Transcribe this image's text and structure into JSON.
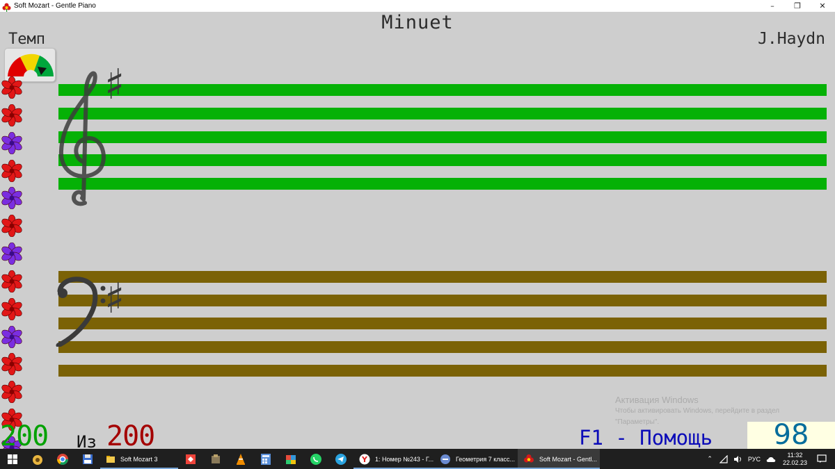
{
  "window": {
    "title": "Soft Mozart - Gentle Piano",
    "minimize": "–",
    "maximize": "❐",
    "close": "✕"
  },
  "score": {
    "title": "Minuet",
    "composer": "J.Haydn"
  },
  "tempo": {
    "label": "Темп",
    "gauge_colors": [
      "#e00000",
      "#f2d600",
      "#00a63c"
    ]
  },
  "staves": {
    "treble_color": "#05b106",
    "bass_color": "#7b6206",
    "key_signature": "♯"
  },
  "flowers": [
    "red",
    "red",
    "purple",
    "red",
    "purple",
    "red",
    "purple",
    "red",
    "red",
    "purple",
    "red",
    "red",
    "red",
    "purple"
  ],
  "footer": {
    "correct": "200",
    "of_label": "Из",
    "total": "200",
    "help": "F1 - Помощь",
    "counter": "98"
  },
  "watermark": {
    "line1": "Активация Windows",
    "line2": "Чтобы активировать Windows, перейдите в раздел",
    "line3": "\"Параметры\"."
  },
  "taskbar": {
    "apps": [
      {
        "label": "Soft Mozart 3"
      },
      {
        "label": "1: Номер №243 - Г..."
      },
      {
        "label": "Геометрия 7 класс..."
      },
      {
        "label": "Soft Mozart - Gentl..."
      }
    ],
    "language": "РУС",
    "time": "11:32",
    "date": "22.02.23"
  }
}
